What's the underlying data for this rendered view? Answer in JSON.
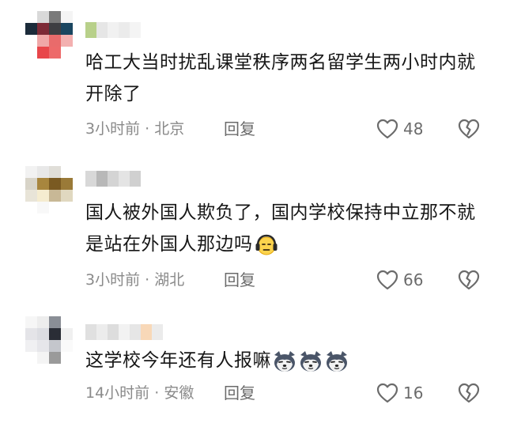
{
  "comments": [
    {
      "text": "哈工大当时扰乱课堂秩序两名留学生两小时内就开除了",
      "time": "3小时前",
      "location": "北京",
      "reply_label": "回复",
      "likes": "48"
    },
    {
      "text": "国人被外国人欺负了，国内学校保持中立那不就是站在外国人那边吗",
      "emoji": [
        "face-with-headphones-emoji"
      ],
      "time": "3小时前",
      "location": "湖北",
      "reply_label": "回复",
      "likes": "66"
    },
    {
      "text": "这学校今年还有人报嘛",
      "emoji": [
        "husky-emoji",
        "husky-emoji",
        "husky-emoji"
      ],
      "time": "14小时前",
      "location": "安徽",
      "reply_label": "回复",
      "likes": "16"
    }
  ],
  "separator": "·",
  "colors": {
    "text": "#161616",
    "meta": "#8a8a8a",
    "icon": "#6b6b6b"
  }
}
